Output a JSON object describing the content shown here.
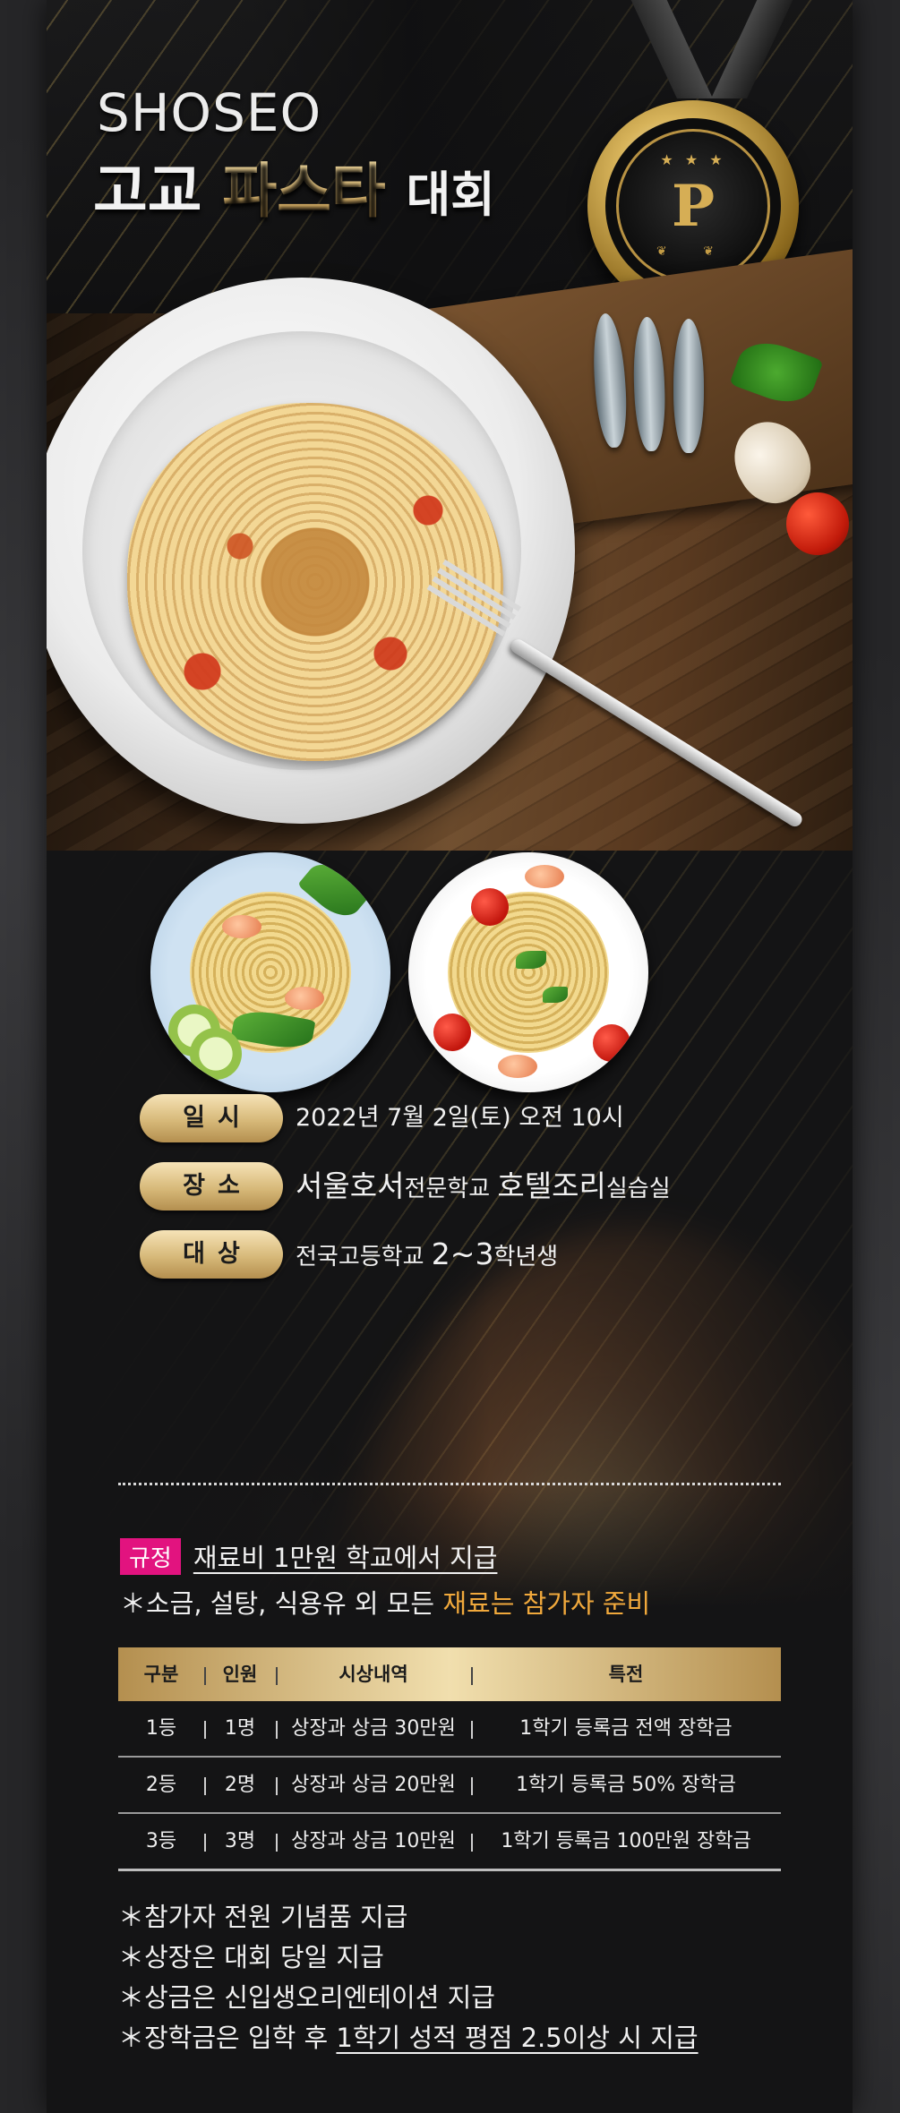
{
  "header": {
    "brand": "SHOSEO",
    "title_part1": "고교",
    "title_part2": "파스타",
    "title_part3": "대회"
  },
  "medal": {
    "letter": "P",
    "stars": "★ ★ ★",
    "laurel": "❦ ❦",
    "color": "#d6ae55"
  },
  "info": [
    {
      "label": "일시",
      "value": "2022년 7월 2일(토) 오전 10시"
    },
    {
      "label": "장소",
      "value_parts": [
        "서울호서",
        "전문학교 ",
        "호텔조리",
        "실습실"
      ]
    },
    {
      "label": "대상",
      "value_parts": [
        "전국고등학교 ",
        "2~3",
        "학년생"
      ]
    }
  ],
  "rules": {
    "tag": "규정",
    "main": "재료비 1만원 학교에서 지급",
    "sub_prefix": "＊소금, 설탕, 식용유 외 모든 ",
    "sub_highlight": "재료는 참가자 준비",
    "highlight_color": "#f1a93c",
    "tag_color": "#e2137f"
  },
  "table": {
    "headers": [
      "구분",
      "인원",
      "시상내역",
      "특전"
    ],
    "rows": [
      [
        "1등",
        "1명",
        "상장과 상금 30만원",
        "1학기 등록금 전액 장학금"
      ],
      [
        "2등",
        "2명",
        "상장과 상금 20만원",
        "1학기 등록금 50% 장학금"
      ],
      [
        "3등",
        "3명",
        "상장과 상금 10만원",
        "1학기 등록금 100만원 장학금"
      ]
    ]
  },
  "notes": [
    "＊참가자 전원 기념품 지급",
    "＊상장은 대회 당일 지급",
    "＊상금은 신입생오리엔테이션 지급"
  ],
  "note_last": {
    "prefix": "＊장학금은 입학 후 ",
    "underlined": "1학기 성적 평점 2.5이상 시 지급"
  }
}
